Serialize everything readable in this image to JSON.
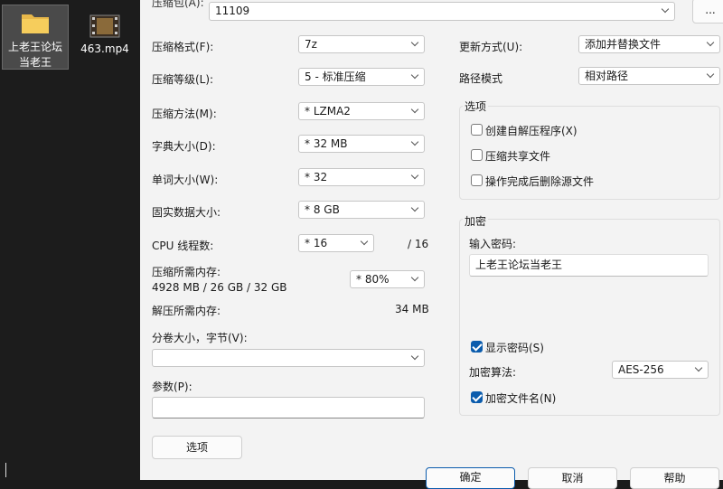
{
  "desktop": {
    "icons": [
      {
        "label_line1": "上老王论坛",
        "label_line2": "当老王",
        "icon": "folder-icon"
      },
      {
        "label": "463.mp4",
        "icon": "video-file-icon"
      }
    ]
  },
  "dialog": {
    "archive_label": "压缩包(A):",
    "archive_value": "11109",
    "browse_label": "...",
    "left": {
      "format_label": "压缩格式(F):",
      "format_value": "7z",
      "level_label": "压缩等级(L):",
      "level_value": "5 - 标准压缩",
      "method_label": "压缩方法(M):",
      "method_value": "*  LZMA2",
      "dict_label": "字典大小(D):",
      "dict_value": "*  32 MB",
      "word_label": "单词大小(W):",
      "word_value": "*  32",
      "solid_label": "固实数据大小:",
      "solid_value": "*  8 GB",
      "cpu_label": "CPU 线程数:",
      "cpu_value": "*  16",
      "cpu_max": "/ 16",
      "mem_label": "压缩所需内存:",
      "mem_detail": "4928 MB / 26 GB / 32 GB",
      "mem_value": "*  80%",
      "decomp_label": "解压所需内存:",
      "decomp_value": "34 MB",
      "split_label": "分卷大小，字节(V):",
      "split_value": "",
      "params_label": "参数(P):",
      "params_value": "",
      "options_button": "选项"
    },
    "right": {
      "update_label": "更新方式(U):",
      "update_value": "添加并替换文件",
      "path_label": "路径模式",
      "path_value": "相对路径",
      "options_group": "选项",
      "opt_sfx": "创建自解压程序(X)",
      "opt_shared": "压缩共享文件",
      "opt_delete": "操作完成后删除源文件",
      "encrypt_group": "加密",
      "password_label": "输入密码:",
      "password_value": "上老王论坛当老王",
      "show_password": "显示密码(S)",
      "method_label": "加密算法:",
      "method_value": "AES-256",
      "encrypt_names": "加密文件名(N)"
    },
    "buttons": {
      "ok": "确定",
      "cancel": "取消",
      "help": "帮助"
    }
  }
}
